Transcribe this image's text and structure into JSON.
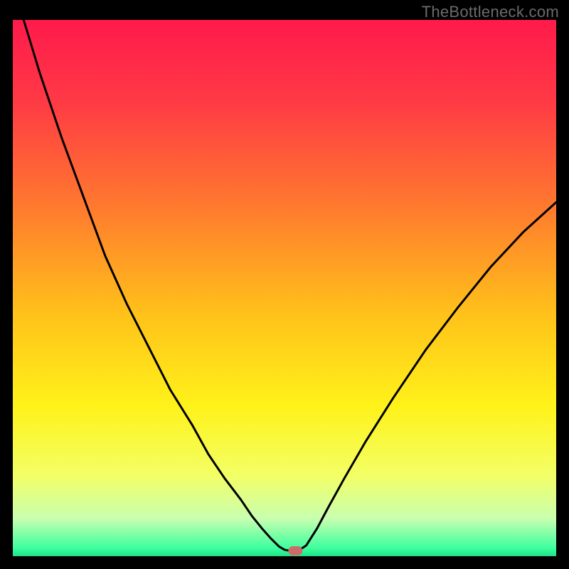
{
  "watermark": "TheBottleneck.com",
  "chart_data": {
    "type": "line",
    "title": "",
    "xlabel": "",
    "ylabel": "",
    "xlim": [
      0,
      100
    ],
    "ylim": [
      0,
      100
    ],
    "grid": false,
    "legend": false,
    "gradient_stops": [
      {
        "offset": 0.0,
        "color": "#ff1a4b"
      },
      {
        "offset": 0.15,
        "color": "#ff3945"
      },
      {
        "offset": 0.35,
        "color": "#ff7a2e"
      },
      {
        "offset": 0.55,
        "color": "#ffc21a"
      },
      {
        "offset": 0.72,
        "color": "#fff21a"
      },
      {
        "offset": 0.85,
        "color": "#f3ff66"
      },
      {
        "offset": 0.93,
        "color": "#c8ffb0"
      },
      {
        "offset": 0.985,
        "color": "#3dff9e"
      },
      {
        "offset": 1.0,
        "color": "#1de28a"
      }
    ],
    "series": [
      {
        "name": "curve",
        "color": "#000000",
        "x": [
          2,
          5,
          9,
          13,
          17,
          21,
          25,
          29,
          33,
          36,
          39,
          42,
          44,
          46,
          47.5,
          49,
          50,
          51,
          52.5,
          54,
          56,
          58,
          61,
          65,
          70,
          76,
          82,
          88,
          94,
          100
        ],
        "y": [
          100,
          90,
          78,
          67,
          56,
          47,
          39,
          31,
          24.5,
          19,
          14.5,
          10.5,
          7.5,
          5,
          3.3,
          1.8,
          1.2,
          1.0,
          1.0,
          2.0,
          5.2,
          9.0,
          14.5,
          21.5,
          29.5,
          38.5,
          46.5,
          54.0,
          60.5,
          66.0
        ]
      }
    ],
    "marker": {
      "shape": "stadium",
      "cx": 52.0,
      "cy": 1.0,
      "rx": 1.3,
      "ry": 0.85,
      "fill": "#cf6a6a"
    }
  }
}
